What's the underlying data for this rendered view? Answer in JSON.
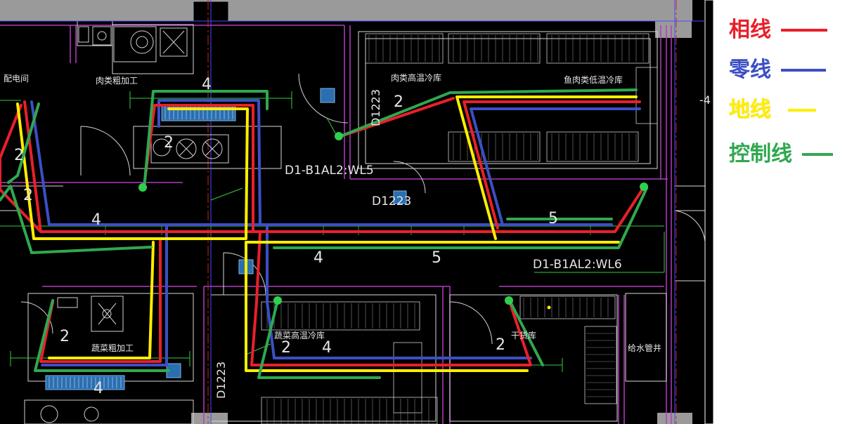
{
  "legend": {
    "items": [
      {
        "label": "相线",
        "color": "#e8202a"
      },
      {
        "label": "零线",
        "color": "#3b4fc4"
      },
      {
        "label": "地线",
        "color": "#ffee00"
      },
      {
        "label": "控制线",
        "color": "#2fa84f"
      }
    ]
  },
  "rooms": {
    "distribution_room": "配电间",
    "meat_processing": "肉类粗加工",
    "meat_high_temp_cold_storage": "肉类高温冷库",
    "fish_meat_low_temp_cold_storage": "鱼肉类低温冷库",
    "vegetable_processing": "蔬菜粗加工",
    "vegetable_high_temp_cold_storage": "蔬菜高温冷库",
    "dry_storage": "干货库",
    "water_pipe_well": "给水管井"
  },
  "circuits": {
    "wl5": "D1-B1AL2:WL5",
    "wl6": "D1-B1AL2:WL6"
  },
  "door_tags": {
    "d1223_upper": "D1223",
    "d1223_center": "D1223",
    "d1223_lower": "D1223"
  },
  "wire_counts": {
    "c2": "2",
    "c4": "4",
    "c5": "5"
  },
  "edge_text": "-4"
}
